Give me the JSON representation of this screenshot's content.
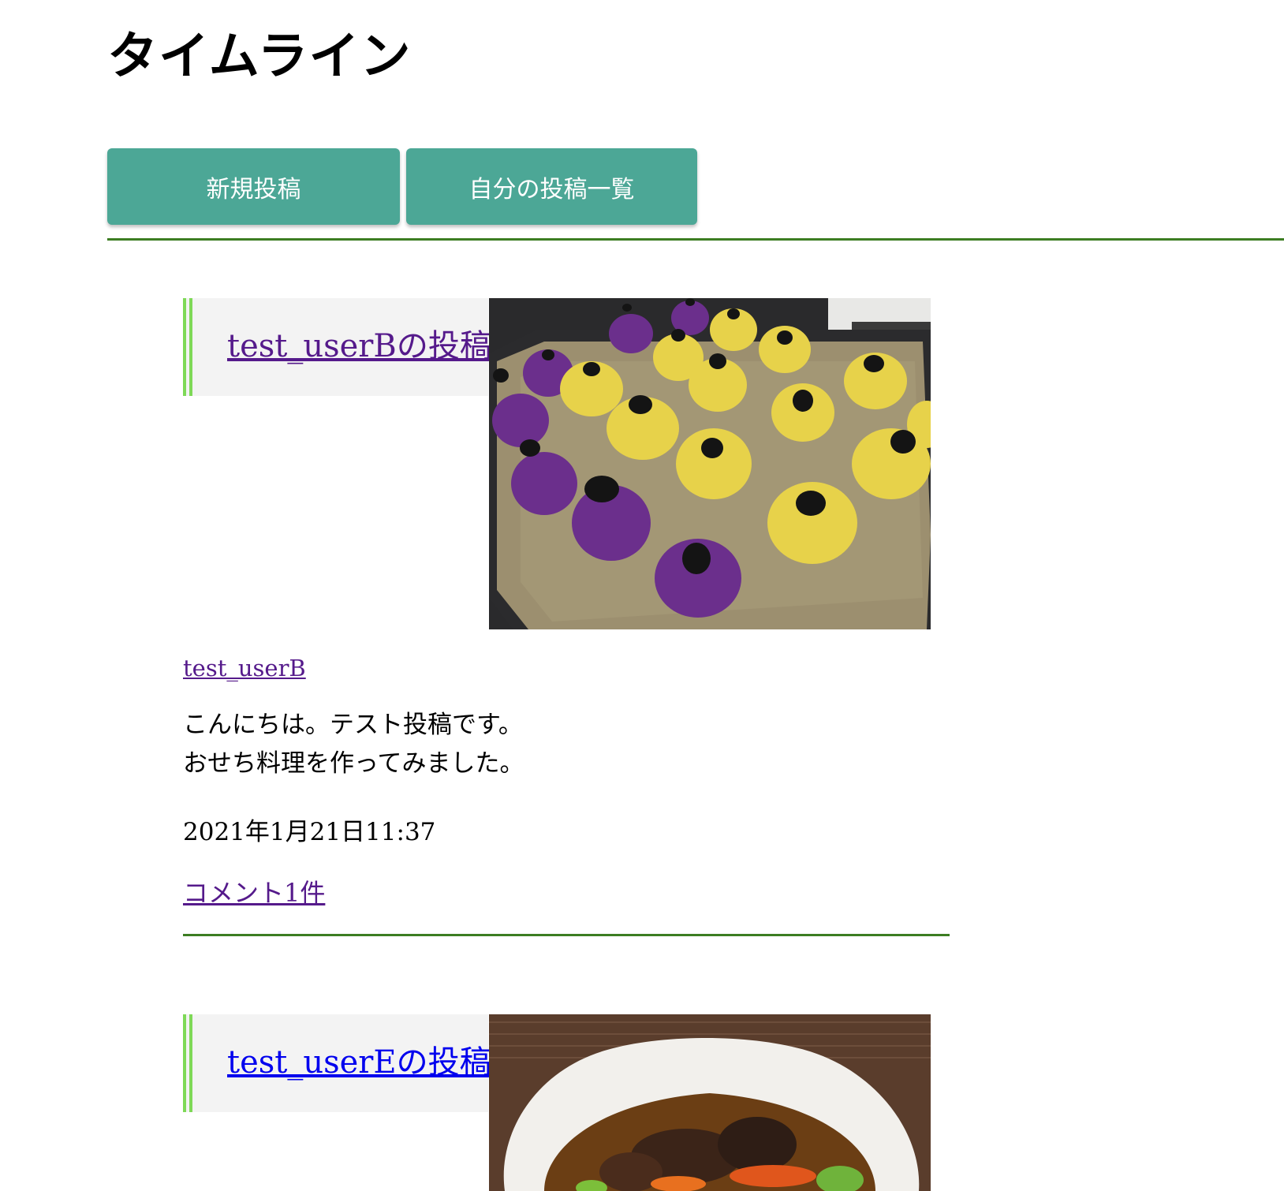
{
  "header": {
    "title": "タイムライン"
  },
  "nav": {
    "new_post_label": "新規投稿",
    "my_posts_label": "自分の投稿一覧"
  },
  "posts": [
    {
      "title": "test_userBの投稿",
      "user": "test_userB",
      "body_lines": [
        "こんにちは。テスト投稿です。",
        "おせち料理を作ってみました。"
      ],
      "date": "2021年1月21日11:37",
      "comments": "コメント1件"
    },
    {
      "title": "test_userEの投稿"
    }
  ],
  "colors": {
    "button": "#4ca796",
    "rule": "#3c7d22",
    "title_bar": "#7ed957",
    "visited_link": "#551a8b",
    "link": "#0000ee"
  }
}
